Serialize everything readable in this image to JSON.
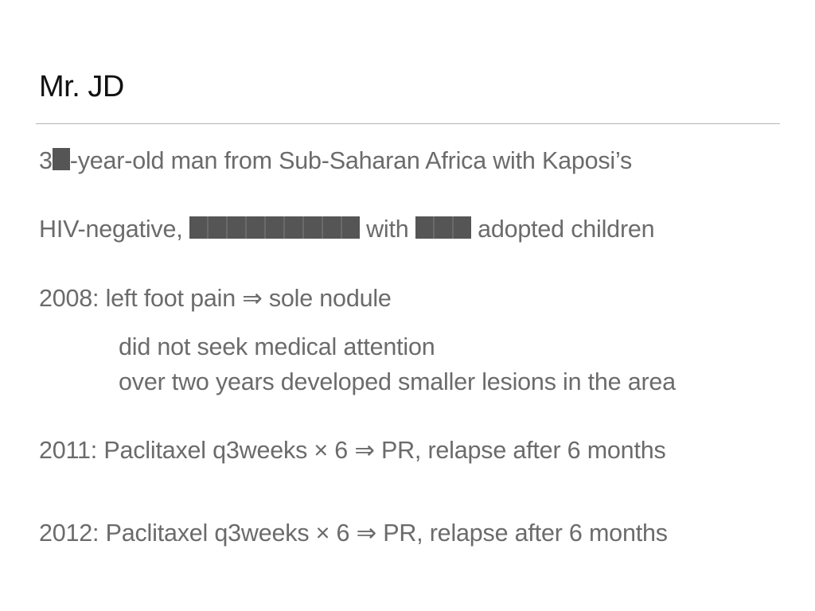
{
  "slide": {
    "title": "Mr. JD",
    "line1": {
      "prefix": "3",
      "suffix": "-year-old man from Sub-Saharan Africa with Kaposi’s"
    },
    "line2": {
      "prefix": "HIV-negative,",
      "middle": "with",
      "suffix": "adopted children"
    },
    "line3": "2008: left foot pain ⇒ sole nodule",
    "line4": "did not seek medical attention",
    "line5": "over two years developed smaller lesions in the area",
    "line6": "2011: Paclitaxel q3weeks × 6 ⇒ PR, relapse after 6 months",
    "line7": "2012: Paclitaxel q3weeks × 6 ⇒ PR, relapse after 6 months"
  },
  "colors": {
    "title": "#111111",
    "body": "#6b6b6b",
    "rule": "#b5b5b5",
    "redaction": "#555555"
  }
}
